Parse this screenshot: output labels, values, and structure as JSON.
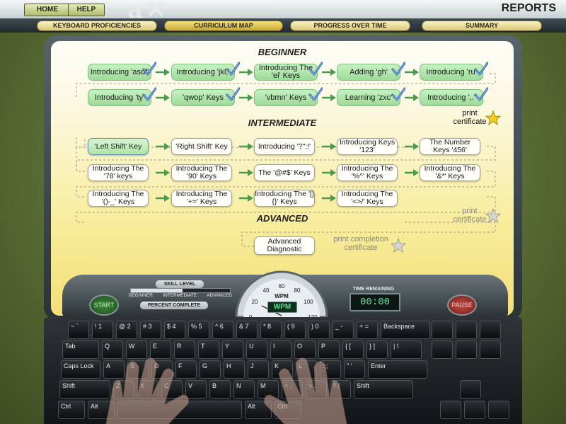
{
  "header": {
    "home_label": "HOME",
    "help_label": "HELP",
    "title": "REPORTS"
  },
  "tabs": [
    {
      "label": "KEYBOARD PROFICIENCIES",
      "active": false
    },
    {
      "label": "CURRICULUM MAP",
      "active": true
    },
    {
      "label": "PROGRESS OVER TIME",
      "active": false
    },
    {
      "label": "SUMMARY",
      "active": false
    }
  ],
  "curriculum": {
    "beginner_heading": "BEGINNER",
    "intermediate_heading": "INTERMEDIATE",
    "advanced_heading": "ADVANCED",
    "beginner": [
      [
        "Introducing 'asdf'",
        "Introducing 'jkl;'",
        "Introducing The 'ei' Keys",
        "Adding 'gh'",
        "Introducing 'ru'"
      ],
      [
        "Introducing 'ty'",
        "'qwop' Keys",
        "'vbmn' Keys",
        "Learning 'zxc'",
        "Introducing ',.'"
      ]
    ],
    "intermediate": [
      [
        "'Left Shift' Key",
        "'Right Shift' Key",
        "Introducing '?\":!'",
        "Introducing Keys '123'",
        "The Number Keys '456'"
      ],
      [
        "Introducing The '78' keys",
        "Introducing The '90' Keys",
        "The '@#$' Keys",
        "Introducing The '%^' Keys",
        "Introducing The '&*' Keys"
      ],
      [
        "Introducing The '()-_' Keys",
        "Introducing The '+=' Keys",
        "Introducing The '[]{}' Keys",
        "Introducing The '<>/' Keys"
      ]
    ],
    "advanced": [
      "Advanced Diagnostic"
    ],
    "beginner_certificate": "print certificate",
    "intermediate_certificate": "print certificate",
    "completion_certificate": "print completion certificate"
  },
  "dashboard": {
    "skill_level_label": "SKILL LEVEL",
    "levels": [
      "BEGINNER",
      "INTERMEDIATE",
      "ADVANCED"
    ],
    "percent_complete_label": "PERCENT COMPLETE",
    "wpm_label": "WPM",
    "wpm_button": "WPM",
    "gauge_ticks": [
      "0",
      "20",
      "40",
      "60",
      "80",
      "100",
      "120"
    ],
    "time_remaining_label": "TIME REMAINING",
    "time_remaining": "00:00",
    "start_label": "START",
    "pause_label": "PAUSE"
  },
  "keyboard": {
    "row1": [
      "~ `",
      "! 1",
      "@ 2",
      "# 3",
      "$ 4",
      "% 5",
      "^ 6",
      "& 7",
      "* 8",
      "( 9",
      ") 0",
      "_ -",
      "+ =",
      "Backspace"
    ],
    "row2": [
      "Tab",
      "Q",
      "W",
      "E",
      "R",
      "T",
      "Y",
      "U",
      "I",
      "O",
      "P",
      "{ [",
      "} ]",
      "| \\"
    ],
    "row3": [
      "Caps Lock",
      "A",
      "S",
      "D",
      "F",
      "G",
      "H",
      "J",
      "K",
      "L",
      ": ;",
      "\" '",
      "Enter"
    ],
    "row4": [
      "Shift",
      "Z",
      "X",
      "C",
      "V",
      "B",
      "N",
      "M",
      "< ,",
      "> .",
      "? /",
      "Shift"
    ],
    "row5": [
      "Ctrl",
      "Alt",
      "",
      "Alt",
      "Ctrl"
    ]
  }
}
